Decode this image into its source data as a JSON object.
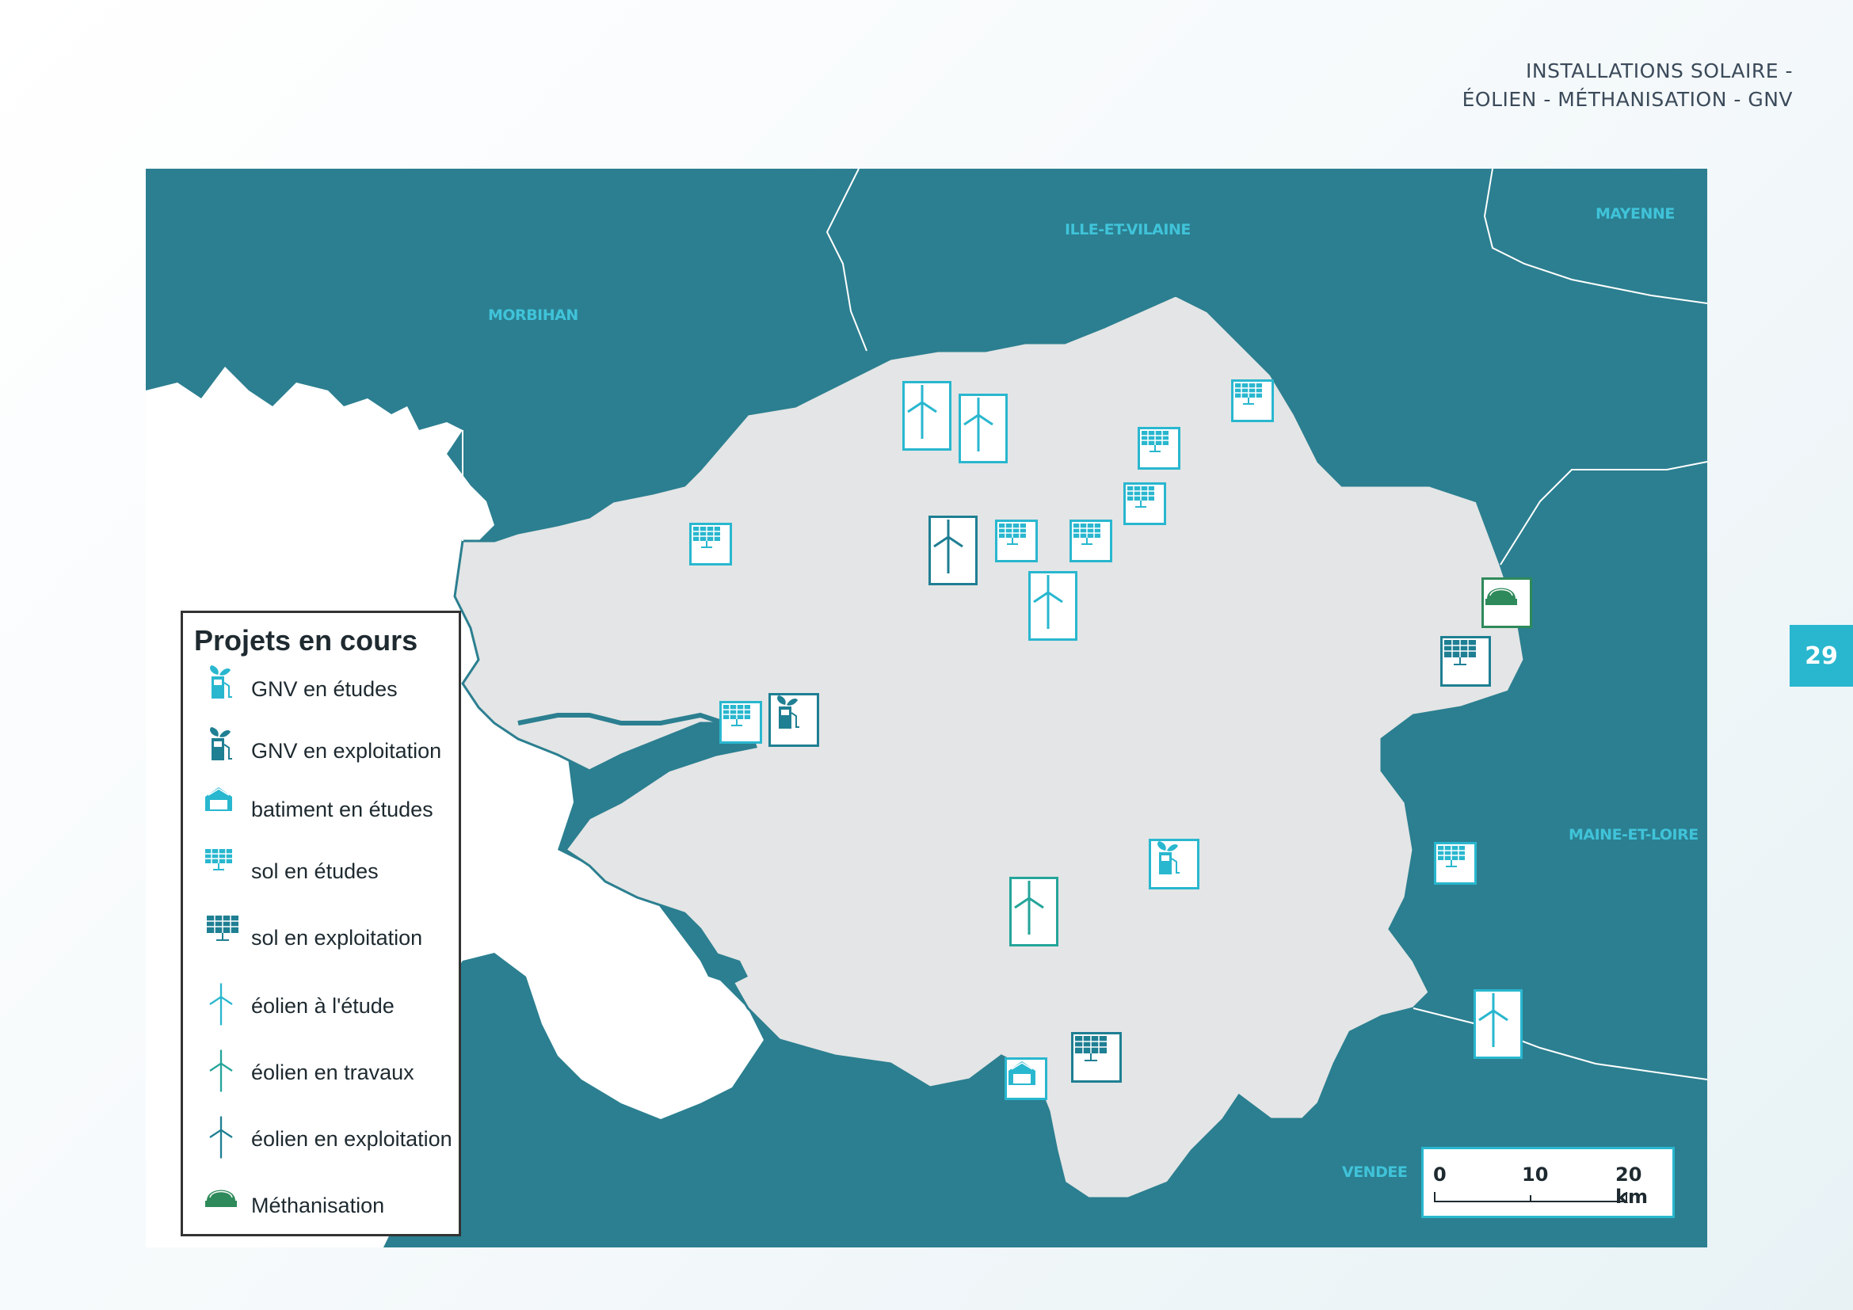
{
  "header": {
    "line1": "INSTALLATIONS SOLAIRE -",
    "line2": "ÉOLIEN - MÉTHANISATION - GNV"
  },
  "page_number": "29",
  "departments": {
    "morbihan": "MORBIHAN",
    "ille_et_vilaine": "ILLE-ET-VILAINE",
    "mayenne": "MAYENNE",
    "maine_et_loire": "MAINE-ET-LOIRE",
    "vendee": "VENDEE"
  },
  "legend": {
    "title": "Projets en cours",
    "items": [
      {
        "label": "GNV en études",
        "icon": "gnv-icon",
        "color": "#29b7cf"
      },
      {
        "label": "GNV en exploitation",
        "icon": "gnv-icon",
        "color": "#1f7f93"
      },
      {
        "label": "batiment en études",
        "icon": "building-solar-icon",
        "color": "#29b7cf"
      },
      {
        "label": "sol en études",
        "icon": "solar-panel-icon",
        "color": "#29b7cf"
      },
      {
        "label": "sol en exploitation",
        "icon": "solar-panel-icon",
        "color": "#1f7f93"
      },
      {
        "label": "éolien à l'étude",
        "icon": "wind-turbine-icon",
        "color": "#29b7cf"
      },
      {
        "label": "éolien en travaux",
        "icon": "wind-turbine-icon",
        "color": "#25a59a"
      },
      {
        "label": "éolien en exploitation",
        "icon": "wind-turbine-icon",
        "color": "#1f7f93"
      },
      {
        "label": "Méthanisation",
        "icon": "methanisation-icon",
        "color": "#2e8a5a"
      }
    ]
  },
  "scale": {
    "t0": "0",
    "t1": "10",
    "t2": "20 km"
  },
  "colors": {
    "sea": "#2b7f90",
    "land": "#e4e5e6",
    "accent": "#29b7cf",
    "dark": "#1f7f93"
  }
}
